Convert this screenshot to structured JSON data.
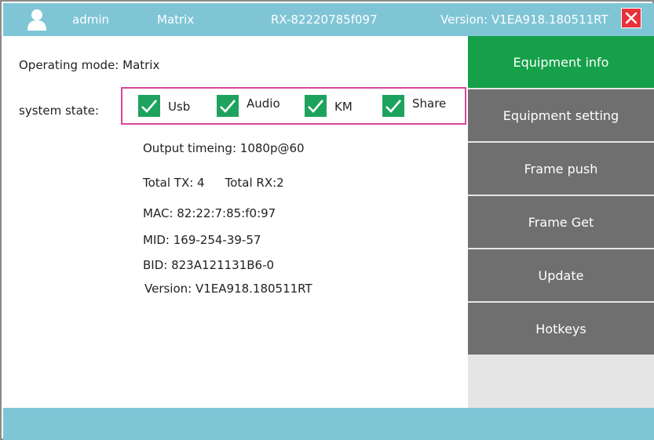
{
  "header": {
    "user": "admin",
    "mode": "Matrix",
    "device_id": "RX-82220785f097",
    "version": "Version: V1EA918.180511RT",
    "icons": {
      "user": "user-icon",
      "close": "close-icon"
    }
  },
  "main": {
    "operating_mode": "Operating mode: Matrix",
    "system_state_label": "system state:",
    "states": [
      {
        "label": "Usb",
        "checked": true
      },
      {
        "label": "Audio",
        "checked": true
      },
      {
        "label": "KM",
        "checked": true
      },
      {
        "label": "Share",
        "checked": true
      }
    ],
    "output_timing": "Output timeing: 1080p@60",
    "total_tx": "Total TX: 4",
    "total_rx": "Total RX:2",
    "mac": "MAC: 82:22:7:85:f0:97",
    "mid": "MID:  169-254-39-57",
    "bid": "BID: 823A121131B6-0",
    "version": "Version: V1EA918.180511RT"
  },
  "sidebar": {
    "items": [
      {
        "label": "Equipment info",
        "active": true
      },
      {
        "label": "Equipment setting",
        "active": false
      },
      {
        "label": "Frame push",
        "active": false
      },
      {
        "label": "Frame Get",
        "active": false
      },
      {
        "label": "Update",
        "active": false
      },
      {
        "label": "Hotkeys",
        "active": false
      }
    ]
  },
  "colors": {
    "bar": "#7fc5d6",
    "active_nav": "#15a049",
    "nav": "#6f6f6f",
    "checkbox": "#1ea35e",
    "highlight_border": "#d6479a",
    "close": "#e8323a"
  }
}
